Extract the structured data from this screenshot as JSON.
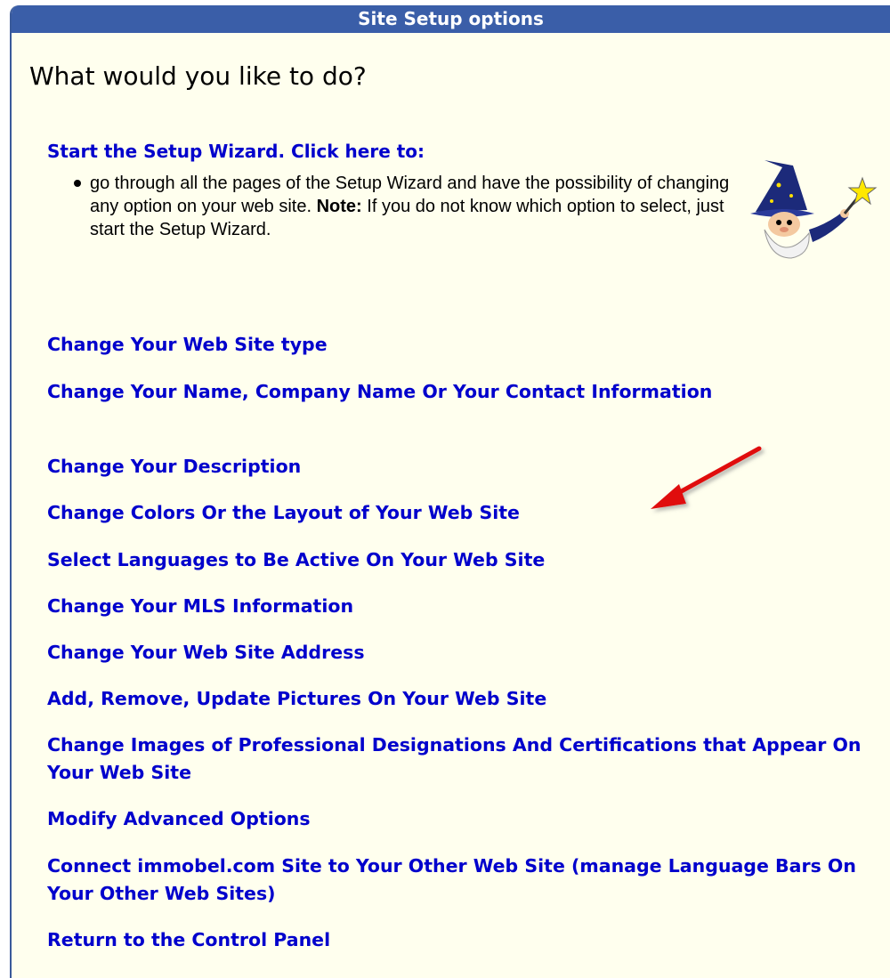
{
  "header": {
    "title": "Site Setup options"
  },
  "main": {
    "question": "What would you like to do?",
    "wizard": {
      "link_label": "Start the Setup Wizard. Click here to:",
      "bullet_text_before_note": "go through all the pages of the Setup Wizard and have the possibility of changing any option on your web site. ",
      "note_label": "Note:",
      "bullet_text_after_note": " If you do not know which option to select, just start the Setup Wizard.",
      "icon": "wizard-icon"
    },
    "links": [
      {
        "label": "Change Your Web Site type"
      },
      {
        "label": "Change Your Name, Company Name Or Your Contact Information"
      },
      {
        "label": "Change Your Description"
      },
      {
        "label": "Change Colors Or the Layout of Your Web Site"
      },
      {
        "label": "Select Languages to Be Active On Your Web Site"
      },
      {
        "label": "Change Your MLS Information"
      },
      {
        "label": "Change Your Web Site Address"
      },
      {
        "label": "Add, Remove, Update Pictures On Your Web Site"
      },
      {
        "label": "Change Images of Professional Designations And Certifications that Appear On Your Web Site"
      },
      {
        "label": "Modify Advanced Options"
      },
      {
        "label": "Connect immobel.com Site to Your Other Web Site (manage Language Bars On Your Other Web Sites)"
      },
      {
        "label": "Return to the Control Panel"
      }
    ]
  },
  "colors": {
    "header_bg": "#3a5ea8",
    "panel_bg": "#ffffee",
    "link": "#0000cc",
    "arrow": "#e01010"
  }
}
